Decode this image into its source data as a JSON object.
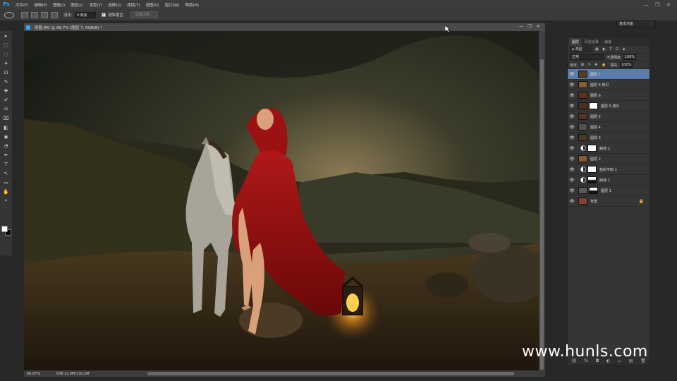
{
  "app": {
    "logo": "Ps",
    "menu": [
      "文件(F)",
      "编辑(E)",
      "图像(I)",
      "图层(L)",
      "类型(Y)",
      "选择(S)",
      "滤镜(T)",
      "视图(V)",
      "窗口(W)",
      "帮助(H)"
    ],
    "window_controls": [
      "—",
      "❐",
      "✕"
    ]
  },
  "options": {
    "feather_label": "羽化:",
    "feather_value": "0 像素",
    "antialias_label": "消除锯齿",
    "refine_button": "调整边缘...",
    "workspace": "基本功能"
  },
  "tools": [
    "▸",
    "⬚",
    "◌",
    "✦",
    "⊡",
    "✎",
    "✚",
    "✐",
    "⎌",
    "⌧",
    "◧",
    "◉",
    "◔",
    "✒",
    "T",
    "↖",
    "▭",
    "✋",
    "⌕"
  ],
  "document": {
    "title": "原图.JPG @ 66.7% (图层 7, RGB/8) *",
    "zoom": "66.67%",
    "doc_size": "文档:11.9M/130.2M",
    "controls": [
      "—",
      "❐",
      "✕"
    ]
  },
  "layers_panel": {
    "tabs": [
      "图层",
      "历史记录",
      "通道"
    ],
    "kind": "ρ 类型",
    "blend_mode": "正常",
    "opacity_label": "不透明度:",
    "opacity_value": "100%",
    "lock_label": "锁定:",
    "fill_label": "填充:",
    "fill_value": "100%",
    "layers": [
      {
        "name": "图层 7",
        "selected": true,
        "thumb": "#5a3a22"
      },
      {
        "name": "图层 6 拷贝",
        "selected": false,
        "thumb": "#8a5a30"
      },
      {
        "name": "图层 6",
        "selected": false,
        "thumb": "#5a3420"
      },
      {
        "name": "图层 5 拷贝",
        "selected": false,
        "thumb": "#4a3020",
        "mask": true
      },
      {
        "name": "图层 5",
        "selected": false,
        "thumb": "#553525"
      },
      {
        "name": "图层 4",
        "selected": false,
        "thumb": "#55504a"
      },
      {
        "name": "图层 3",
        "selected": false,
        "thumb": "#4a3a2a"
      },
      {
        "name": "曲线 2",
        "selected": false,
        "adjust": true,
        "mask": true
      },
      {
        "name": "图层 2",
        "selected": false,
        "thumb": "#8a5a30"
      },
      {
        "name": "色彩平衡 1",
        "selected": false,
        "adjust": true,
        "mask": true
      },
      {
        "name": "曲线 1",
        "selected": false,
        "adjust": true,
        "mask": true,
        "mask_dark": true
      },
      {
        "name": "图层 1",
        "selected": false,
        "thumb": "#5a5a5a",
        "mask": true,
        "mask_dark": true
      },
      {
        "name": "背景",
        "selected": false,
        "thumb": "#8a4030",
        "locked": true
      }
    ],
    "footer": [
      "⛓",
      "fx",
      "◘",
      "◐",
      "▭",
      "▤",
      "🗑"
    ]
  },
  "watermark": "www.hunls.com"
}
